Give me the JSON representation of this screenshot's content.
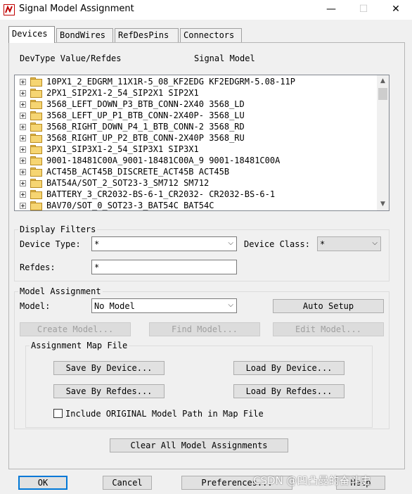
{
  "window": {
    "title": "Signal Model Assignment",
    "minimize": "—",
    "maximize": "☐",
    "close": "✕"
  },
  "tabs": [
    {
      "label": "Devices",
      "active": true
    },
    {
      "label": "BondWires",
      "active": false
    },
    {
      "label": "RefDesPins",
      "active": false
    },
    {
      "label": "Connectors",
      "active": false
    }
  ],
  "list": {
    "header_devtype": "DevType Value/Refdes",
    "header_model": "Signal Model",
    "rows": [
      "10PX1_2_EDGRM_11X1R-5_08_KF2EDG KF2EDGRM-5.08-11P",
      "2PX1_SIP2X1-2_54_SIP2X1 SIP2X1",
      "3568_LEFT_DOWN_P3_BTB_CONN-2X40 3568_LD",
      "3568_LEFT_UP_P1_BTB_CONN-2X40P- 3568_LU",
      "3568_RIGHT_DOWN_P4_1_BTB_CONN-2 3568_RD",
      "3568_RIGHT_UP_P2_BTB_CONN-2X40P 3568_RU",
      "3PX1_SIP3X1-2_54_SIP3X1 SIP3X1",
      "9001-18481C00A_9001-18481C00A_9 9001-18481C00A",
      "ACT45B_ACT45B_DISCRETE_ACT45B ACT45B",
      "BAT54A/SOT_2_SOT23-3_SM712 SM712",
      "BATTERY_3_CR2032-BS-6-1_CR2032- CR2032-BS-6-1",
      "BAV70/SOT_0_SOT23-3_BAT54C BAT54C"
    ],
    "scroll_up": "▲",
    "scroll_down": "▼"
  },
  "display_filters": {
    "title": "Display Filters",
    "device_type_label": "Device Type:",
    "device_type_value": "*",
    "device_class_label": "Device Class:",
    "device_class_value": "*",
    "refdes_label": "Refdes:",
    "refdes_value": "*"
  },
  "model_assignment": {
    "title": "Model Assignment",
    "model_label": "Model:",
    "model_value": "No Model",
    "auto_setup": "Auto Setup",
    "create_model": "Create Model...",
    "find_model": "Find Model...",
    "edit_model": "Edit Model..."
  },
  "map_file": {
    "title": "Assignment Map File",
    "save_by_device": "Save By Device...",
    "load_by_device": "Load By Device...",
    "save_by_refdes": "Save By Refdes...",
    "load_by_refdes": "Load By Refdes...",
    "include_original": "Include ORIGINAL Model Path in Map File",
    "include_original_checked": false
  },
  "clear_all": "Clear All Model Assignments",
  "footer": {
    "ok": "OK",
    "cancel": "Cancel",
    "preferences": "Preferences...",
    "help": "Help"
  },
  "watermark": "CSDN @凹凸曼的奋斗史"
}
